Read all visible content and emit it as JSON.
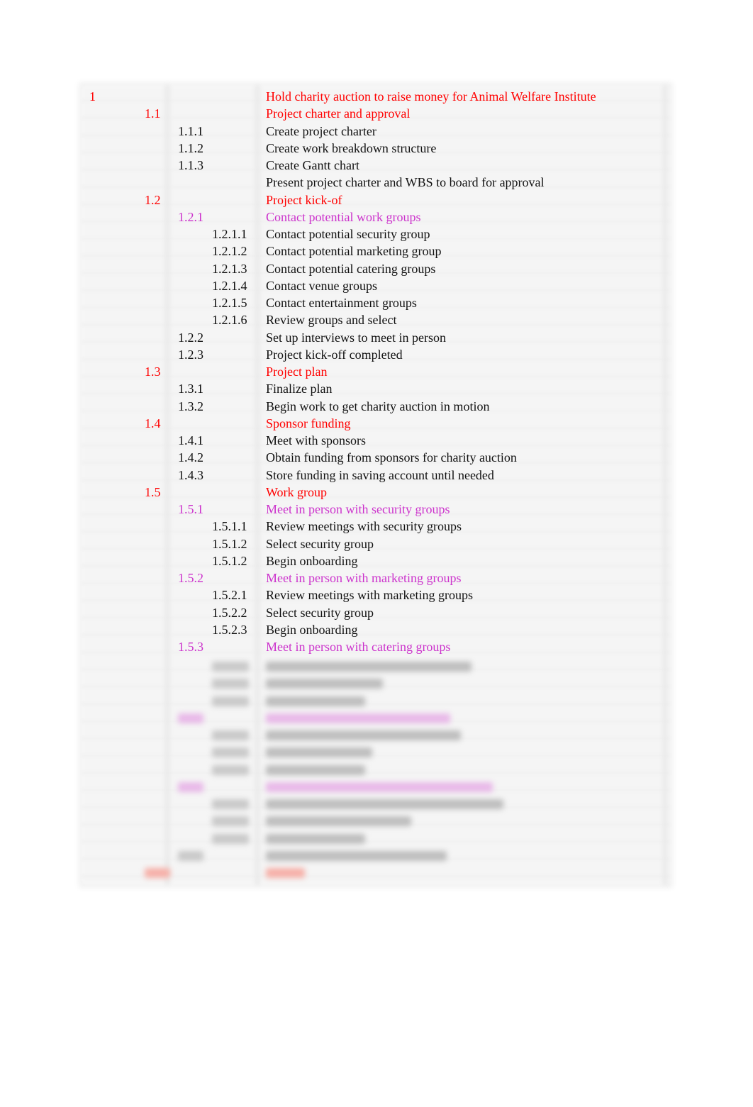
{
  "document": {
    "title": "Hold charity auction to raise money for Animal Welfare Institute",
    "colors": {
      "level1": "#ff0000",
      "level2": "#ff0000",
      "level3_heading": "#cc33cc",
      "task": "#111111"
    },
    "rows": [
      {
        "level": 1,
        "id": "1",
        "text": "Hold charity auction to raise money for Animal Welfare Institute",
        "style": "red"
      },
      {
        "level": 2,
        "id": "1.1",
        "text": "Project charter and approval",
        "style": "red"
      },
      {
        "level": 3,
        "id": "1.1.1",
        "text": "Create project charter",
        "style": "task"
      },
      {
        "level": 3,
        "id": "1.1.2",
        "text": "Create work breakdown structure",
        "style": "task"
      },
      {
        "level": 3,
        "id": "1.1.3",
        "text": "Create Gantt chart",
        "style": "task"
      },
      {
        "level": 3,
        "id": "",
        "text": "Present project charter and WBS to board for approval",
        "style": "task"
      },
      {
        "level": 2,
        "id": "1.2",
        "text": "Project kick-of",
        "style": "red"
      },
      {
        "level": 3,
        "id": "1.2.1",
        "text": "Contact potential work groups",
        "style": "mag"
      },
      {
        "level": 4,
        "id": "1.2.1.1",
        "text": "Contact potential security group",
        "style": "task"
      },
      {
        "level": 4,
        "id": "1.2.1.2",
        "text": "Contact potential marketing group",
        "style": "task"
      },
      {
        "level": 4,
        "id": "1.2.1.3",
        "text": "Contact potential catering groups",
        "style": "task"
      },
      {
        "level": 4,
        "id": "1.2.1.4",
        "text": "Contact venue groups",
        "style": "task"
      },
      {
        "level": 4,
        "id": "1.2.1.5",
        "text": "Contact entertainment groups",
        "style": "task"
      },
      {
        "level": 4,
        "id": "1.2.1.6",
        "text": "Review groups and select",
        "style": "task"
      },
      {
        "level": 3,
        "id": "1.2.2",
        "text": "Set up interviews to meet in person",
        "style": "task"
      },
      {
        "level": 3,
        "id": "1.2.3",
        "text": "Project kick-off completed",
        "style": "task"
      },
      {
        "level": 2,
        "id": "1.3",
        "text": "Project plan",
        "style": "red"
      },
      {
        "level": 3,
        "id": "1.3.1",
        "text": "Finalize plan",
        "style": "task"
      },
      {
        "level": 3,
        "id": "1.3.2",
        "text": "Begin work to get charity auction in motion",
        "style": "task"
      },
      {
        "level": 2,
        "id": "1.4",
        "text": "Sponsor funding",
        "style": "red"
      },
      {
        "level": 3,
        "id": "1.4.1",
        "text": "Meet with sponsors",
        "style": "task"
      },
      {
        "level": 3,
        "id": "1.4.2",
        "text": "Obtain funding from sponsors for charity auction",
        "style": "task"
      },
      {
        "level": 3,
        "id": "1.4.3",
        "text": "Store funding in saving account until needed",
        "style": "task"
      },
      {
        "level": 2,
        "id": "1.5",
        "text": "Work group",
        "style": "red"
      },
      {
        "level": 3,
        "id": "1.5.1",
        "text": "Meet in person with security groups",
        "style": "mag"
      },
      {
        "level": 4,
        "id": "1.5.1.1",
        "text": "Review meetings with security groups",
        "style": "task"
      },
      {
        "level": 4,
        "id": "1.5.1.2",
        "text": "Select security group",
        "style": "task"
      },
      {
        "level": 4,
        "id": "1.5.1.2",
        "text": "Begin onboarding",
        "style": "task"
      },
      {
        "level": 3,
        "id": "1.5.2",
        "text": "Meet in person with marketing groups",
        "style": "mag"
      },
      {
        "level": 4,
        "id": "1.5.2.1",
        "text": "Review meetings with marketing groups",
        "style": "task"
      },
      {
        "level": 4,
        "id": "1.5.2.2",
        "text": "Select security group",
        "style": "task"
      },
      {
        "level": 4,
        "id": "1.5.2.3",
        "text": "Begin onboarding",
        "style": "task"
      },
      {
        "level": 3,
        "id": "1.5.3",
        "text": "Meet in person with catering groups",
        "style": "mag"
      }
    ],
    "blurred_rows": [
      {
        "level": 4,
        "style": "task"
      },
      {
        "level": 4,
        "style": "task"
      },
      {
        "level": 4,
        "style": "task"
      },
      {
        "level": 3,
        "style": "mag"
      },
      {
        "level": 4,
        "style": "task"
      },
      {
        "level": 4,
        "style": "task"
      },
      {
        "level": 4,
        "style": "task"
      },
      {
        "level": 3,
        "style": "mag"
      },
      {
        "level": 4,
        "style": "task"
      },
      {
        "level": 4,
        "style": "task"
      },
      {
        "level": 4,
        "style": "task"
      },
      {
        "level": 3,
        "style": "task"
      },
      {
        "level": 2,
        "style": "red"
      }
    ]
  }
}
